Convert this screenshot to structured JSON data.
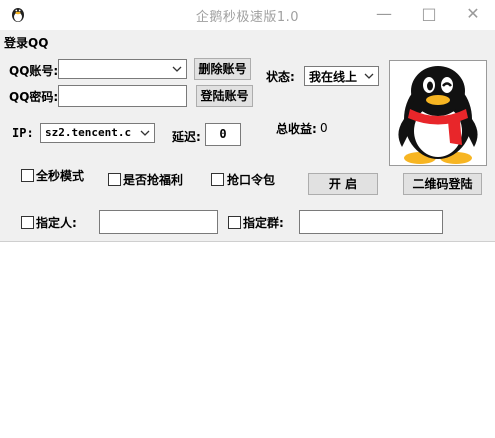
{
  "window": {
    "title": "企鹅秒极速版1.0",
    "min_symbol": "—",
    "max_symbol": "□",
    "close_symbol": "✕"
  },
  "login": {
    "section_title": "登录QQ",
    "qq_account_label": "QQ账号:",
    "qq_account_value": "",
    "qq_password_label": "QQ密码:",
    "qq_password_value": "",
    "delete_account_button": "删除账号",
    "login_account_button": "登陆账号",
    "status_label": "状态:",
    "status_value": "我在线上",
    "ip_label": "IP:",
    "ip_value": "sz2.tencent.c",
    "delay_label": "延迟:",
    "delay_value": "0",
    "total_earnings_label": "总收益:",
    "total_earnings_value": "0"
  },
  "options": {
    "full_second_mode": "全秒模式",
    "grab_welfare": "是否抢福利",
    "grab_password_packet": "抢口令包",
    "start_button": "开 启",
    "qr_login_button": "二维码登陆",
    "specified_person_label": "指定人:",
    "specified_person_value": "",
    "specified_group_label": "指定群:",
    "specified_group_value": ""
  },
  "icons": {
    "app": "penguin-app-icon",
    "avatar": "qq-penguin-avatar",
    "dropdown": "chevron-down-icon"
  },
  "colors": {
    "panel_bg": "#f0f0f0",
    "title_text": "#a0a0a0",
    "penguin_scarf": "#e8262a",
    "penguin_beak": "#f7b522"
  }
}
